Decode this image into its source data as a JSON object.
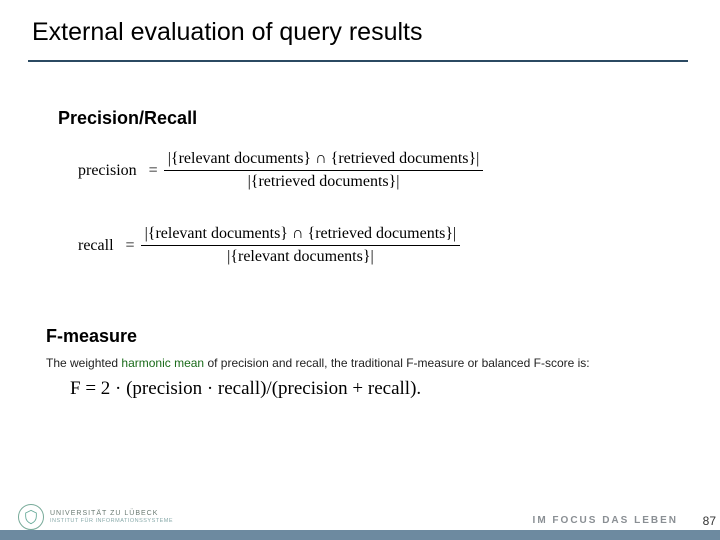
{
  "title": "External evaluation of query results",
  "section": {
    "precision_recall": "Precision/Recall"
  },
  "eq": {
    "precision": {
      "lhs": "precision",
      "num": "|{relevant documents} ∩ {retrieved documents}|",
      "den": "|{retrieved documents}|"
    },
    "recall": {
      "lhs": "recall",
      "num": "|{relevant documents} ∩ {retrieved documents}|",
      "den": "|{relevant documents}|"
    }
  },
  "fmeasure": {
    "heading": "F-measure",
    "desc_pre": "The weighted ",
    "desc_link": "harmonic mean",
    "desc_post": " of precision and recall, the traditional F-measure or balanced F-score is:",
    "formula": "F = 2 · (precision · recall)/(precision + recall)."
  },
  "footer": {
    "page": "87",
    "motto": "IM FOCUS DAS LEBEN",
    "uni_line1": "UNIVERSITÄT ZU LÜBECK",
    "uni_line2": "INSTITUT FÜR INFORMATIONSSYSTEME"
  },
  "glyph": {
    "equals": "="
  }
}
